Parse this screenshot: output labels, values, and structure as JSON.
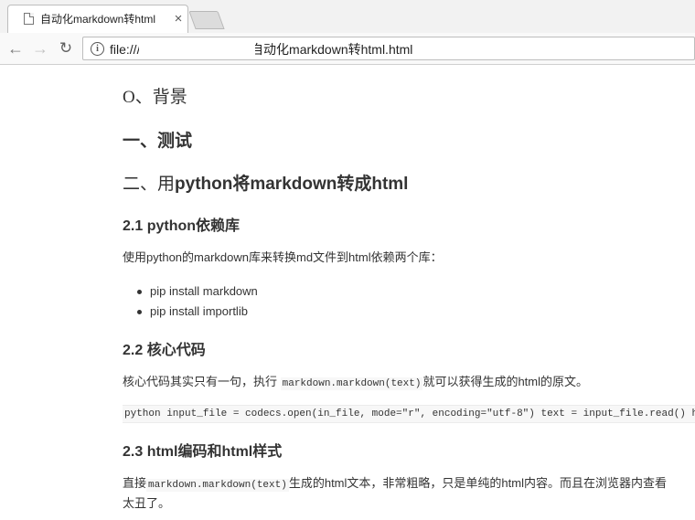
{
  "browser": {
    "tab_title": "自动化markdown转html",
    "tab_close": "×",
    "nav": {
      "back": "←",
      "forward": "→",
      "reload": "↻"
    },
    "info_icon": "i",
    "url": "file:///                         md/自动化markdown转html.html"
  },
  "content": {
    "h1_0": "O、背景",
    "h1_1": "一、测试",
    "h1_2_prefix": "二、用",
    "h1_2_bold": "python将markdown转成html",
    "s21": {
      "title": "2.1 python依赖库",
      "para": "使用python的markdown库来转换md文件到html依赖两个库：",
      "bullets": [
        "pip install markdown",
        "pip install importlib"
      ]
    },
    "s22": {
      "title": "2.2 核心代码",
      "para_before": "核心代码其实只有一句，执行 ",
      "para_code": "markdown.markdown(text)",
      "para_after": "就可以获得生成的html的原文。",
      "codeblock": "python input_file = codecs.open(in_file, mode=\"r\", encoding=\"utf-8\") text = input_file.read() h"
    },
    "s23": {
      "title": "2.3 html编码和html样式",
      "para_before": "直接",
      "para_code": "markdown.markdown(text)",
      "para_after": "生成的html文本，非常粗略，只是单纯的html内容。而且在浏览器内查看",
      "para_line2": "太丑了。"
    }
  }
}
